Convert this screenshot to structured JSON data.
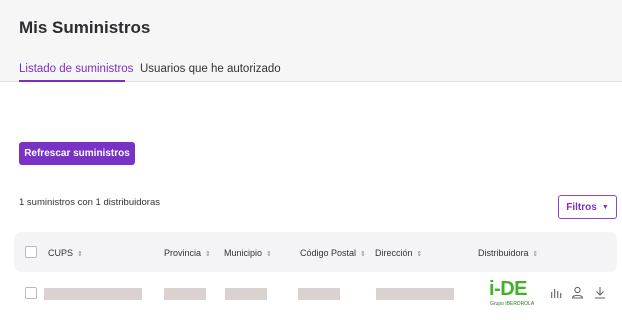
{
  "page": {
    "title": "Mis Suministros"
  },
  "tabs": [
    {
      "label": "Listado de suministros",
      "active": true
    },
    {
      "label": "Usuarios que he autorizado",
      "active": false
    }
  ],
  "actions": {
    "refresh_label": "Refrescar suministros",
    "filters_label": "Filtros"
  },
  "summary": {
    "text": "1 suministros con 1 distribuidoras"
  },
  "table": {
    "columns": [
      "CUPS",
      "Provincia",
      "Municipio",
      "Código Postal",
      "Dirección",
      "Distribuidora"
    ],
    "rows": [
      {
        "distributor_logo": {
          "text": "i-DE",
          "subtext": "Grupo IBERDROLA"
        },
        "row_actions": [
          "chart-icon",
          "user-icon",
          "download-icon"
        ]
      }
    ]
  },
  "colors": {
    "accent": "#7a32c4",
    "logo_green": "#42b028",
    "placeholder_bar": "#dad2cf"
  }
}
